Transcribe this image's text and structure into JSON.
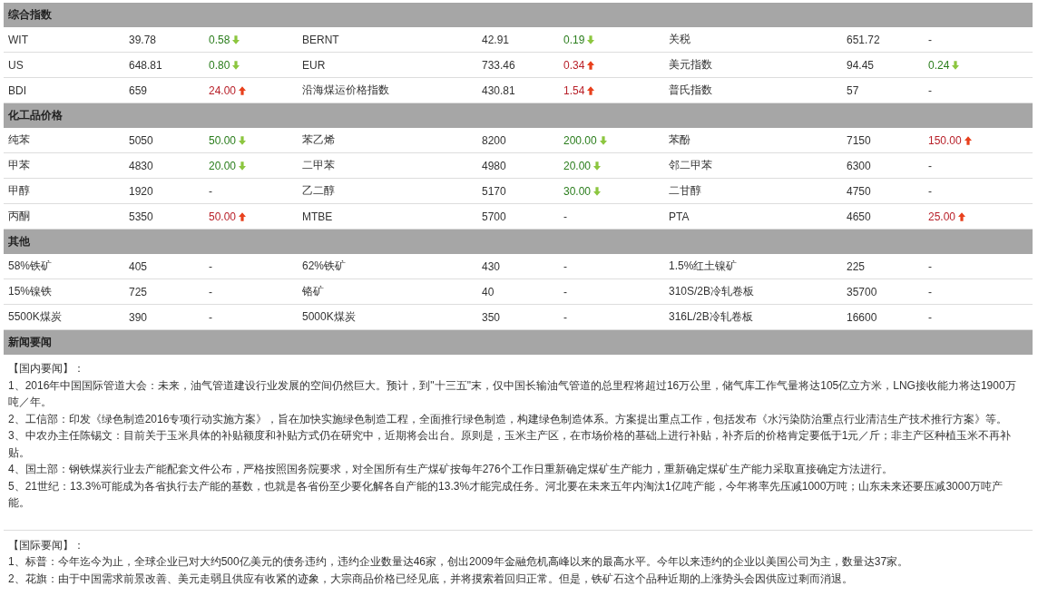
{
  "sections": [
    {
      "title": "综合指数",
      "rows": [
        [
          {
            "name": "WIT",
            "value": "39.78",
            "change": "0.58",
            "kind": "down"
          },
          {
            "name": "BERNT",
            "value": "42.91",
            "change": "0.19",
            "kind": "down"
          },
          {
            "name": "关税",
            "value": "651.72",
            "change": "-",
            "kind": "flat"
          }
        ],
        [
          {
            "name": "US",
            "value": "648.81",
            "change": "0.80",
            "kind": "down"
          },
          {
            "name": "EUR",
            "value": "733.46",
            "change": "0.34",
            "kind": "up"
          },
          {
            "name": "美元指数",
            "value": "94.45",
            "change": "0.24",
            "kind": "down"
          }
        ],
        [
          {
            "name": "BDI",
            "value": "659",
            "change": "24.00",
            "kind": "up"
          },
          {
            "name": "沿海煤运价格指数",
            "value": "430.81",
            "change": "1.54",
            "kind": "up"
          },
          {
            "name": "普氏指数",
            "value": "57",
            "change": "-",
            "kind": "flat"
          }
        ]
      ]
    },
    {
      "title": "化工品价格",
      "rows": [
        [
          {
            "name": "纯苯",
            "value": "5050",
            "change": "50.00",
            "kind": "down"
          },
          {
            "name": "苯乙烯",
            "value": "8200",
            "change": "200.00",
            "kind": "down"
          },
          {
            "name": "苯酚",
            "value": "7150",
            "change": "150.00",
            "kind": "up"
          }
        ],
        [
          {
            "name": "甲苯",
            "value": "4830",
            "change": "20.00",
            "kind": "down"
          },
          {
            "name": "二甲苯",
            "value": "4980",
            "change": "20.00",
            "kind": "down"
          },
          {
            "name": "邻二甲苯",
            "value": "6300",
            "change": "-",
            "kind": "flat"
          }
        ],
        [
          {
            "name": "甲醇",
            "value": "1920",
            "change": "-",
            "kind": "flat"
          },
          {
            "name": "乙二醇",
            "value": "5170",
            "change": "30.00",
            "kind": "down"
          },
          {
            "name": "二甘醇",
            "value": "4750",
            "change": "-",
            "kind": "flat"
          }
        ],
        [
          {
            "name": "丙酮",
            "value": "5350",
            "change": "50.00",
            "kind": "up"
          },
          {
            "name": "MTBE",
            "value": "5700",
            "change": "-",
            "kind": "flat"
          },
          {
            "name": "PTA",
            "value": "4650",
            "change": "25.00",
            "kind": "up"
          }
        ]
      ]
    },
    {
      "title": "其他",
      "rows": [
        [
          {
            "name": "58%铁矿",
            "value": "405",
            "change": "-",
            "kind": "flat"
          },
          {
            "name": "62%铁矿",
            "value": "430",
            "change": "-",
            "kind": "flat"
          },
          {
            "name": "1.5%红土镍矿",
            "value": "225",
            "change": "-",
            "kind": "flat"
          }
        ],
        [
          {
            "name": "15%镍铁",
            "value": "725",
            "change": "-",
            "kind": "flat"
          },
          {
            "name": "铬矿",
            "value": "40",
            "change": "-",
            "kind": "flat"
          },
          {
            "name": "310S/2B冷轧卷板",
            "value": "35700",
            "change": "-",
            "kind": "flat"
          }
        ],
        [
          {
            "name": "5500K煤炭",
            "value": "390",
            "change": "-",
            "kind": "flat"
          },
          {
            "name": "5000K煤炭",
            "value": "350",
            "change": "-",
            "kind": "flat"
          },
          {
            "name": "316L/2B冷轧卷板",
            "value": "16600",
            "change": "-",
            "kind": "flat"
          }
        ]
      ]
    }
  ],
  "news": {
    "title": "新闻要闻",
    "groups": [
      {
        "heading": "【国内要闻】：",
        "items": [
          "1、2016年中国国际管道大会：未来，油气管道建设行业发展的空间仍然巨大。预计，到\"十三五\"末，仅中国长输油气管道的总里程将超过16万公里，储气库工作气量将达105亿立方米，LNG接收能力将达1900万吨／年。",
          "2、工信部：印发《绿色制造2016专项行动实施方案》，旨在加快实施绿色制造工程，全面推行绿色制造，构建绿色制造体系。方案提出重点工作，包括发布《水污染防治重点行业清洁生产技术推行方案》等。",
          "3、中农办主任陈锡文：目前关于玉米具体的补贴额度和补贴方式仍在研究中，近期将会出台。原则是，玉米主产区，在市场价格的基础上进行补贴，补齐后的价格肯定要低于1元／斤；非主产区种植玉米不再补贴。",
          "4、国土部：钢铁煤炭行业去产能配套文件公布，严格按照国务院要求，对全国所有生产煤矿按每年276个工作日重新确定煤矿生产能力，重新确定煤矿生产能力采取直接确定方法进行。",
          "5、21世纪：13.3%可能成为各省执行去产能的基数，也就是各省份至少要化解各自产能的13.3%才能完成任务。河北要在未来五年内淘汰1亿吨产能，今年将率先压减1000万吨；山东未来还要压减3000万吨产能。"
        ]
      },
      {
        "heading": "【国际要闻】：",
        "items": [
          "1、标普：今年迄今为止，全球企业已对大约500亿美元的债务违约，违约企业数量达46家，创出2009年金融危机高峰以来的最高水平。今年以来违约的企业以美国公司为主，数量达37家。",
          "2、花旗：由于中国需求前景改善、美元走弱且供应有收紧的迹象，大宗商品价格已经见底，并将摸索着回归正常。但是，铁矿石这个品种近期的上涨势头会因供应过剩而消退。"
        ]
      }
    ]
  }
}
